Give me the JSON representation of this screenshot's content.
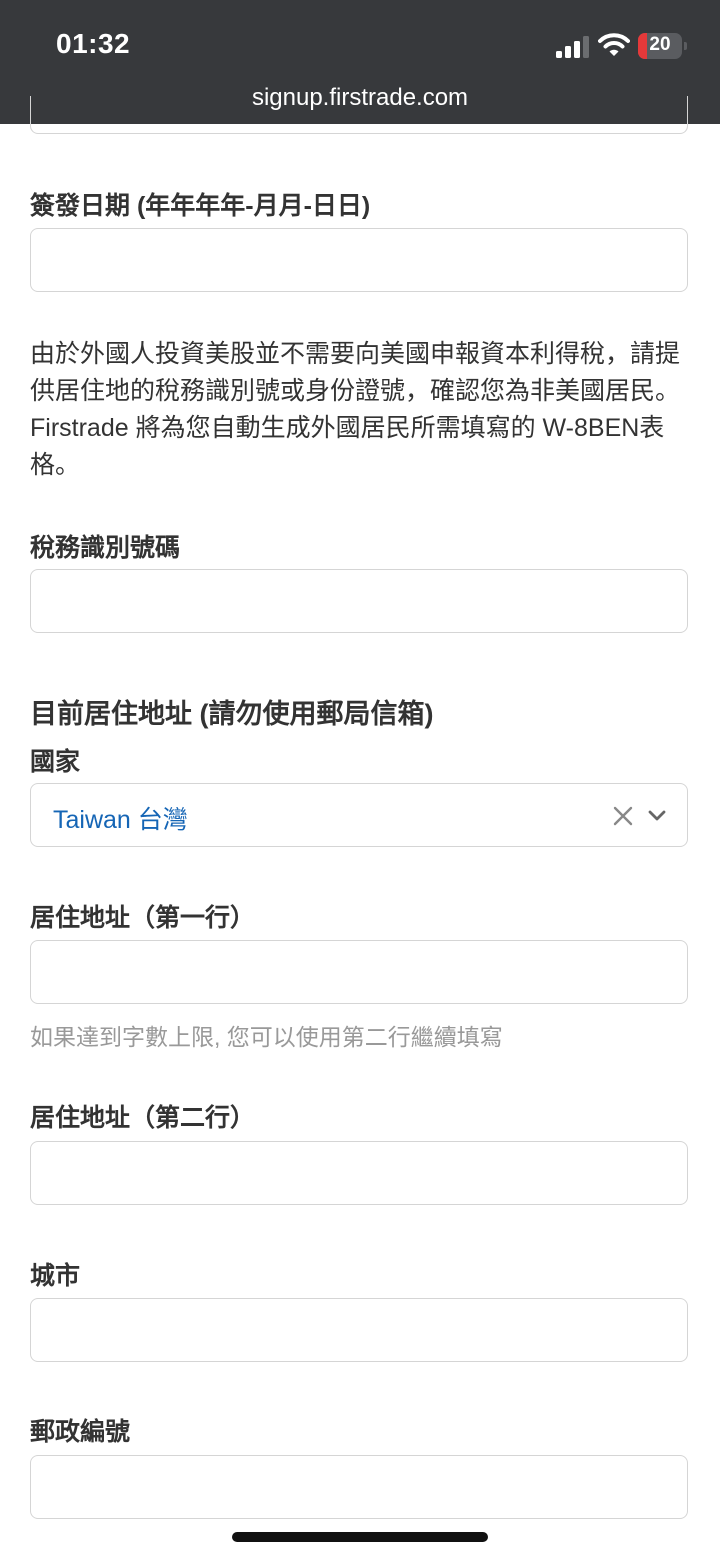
{
  "status_bar": {
    "time": "01:32",
    "battery_level": "20",
    "battery_fraction": 0.2,
    "url": "signup.firstrade.com"
  },
  "form": {
    "issue_date_label": "簽發日期 (年年年年-月月-日日)",
    "description": "由於外國人投資美股並不需要向美國申報資本利得稅，請提供居住地的稅務識別號或身份證號，確認您為非美國居民。 Firstrade 將為您自動生成外國居民所需填寫的 W-8BEN表格。",
    "tax_id_label": "稅務識別號碼",
    "address_section_title": "目前居住地址 (請勿使用郵局信箱)",
    "country_label": "國家",
    "country_value": "Taiwan 台灣",
    "address_line1_label": "居住地址（第一行）",
    "address_line1_help": "如果達到字數上限, 您可以使用第二行繼續填寫",
    "address_line2_label": "居住地址（第二行）",
    "city_label": "城市",
    "postal_code_label": "郵政編號"
  },
  "colors": {
    "status_bar_bg": "#37393c",
    "select_value": "#1565b5",
    "battery_low": "#e5393a"
  }
}
